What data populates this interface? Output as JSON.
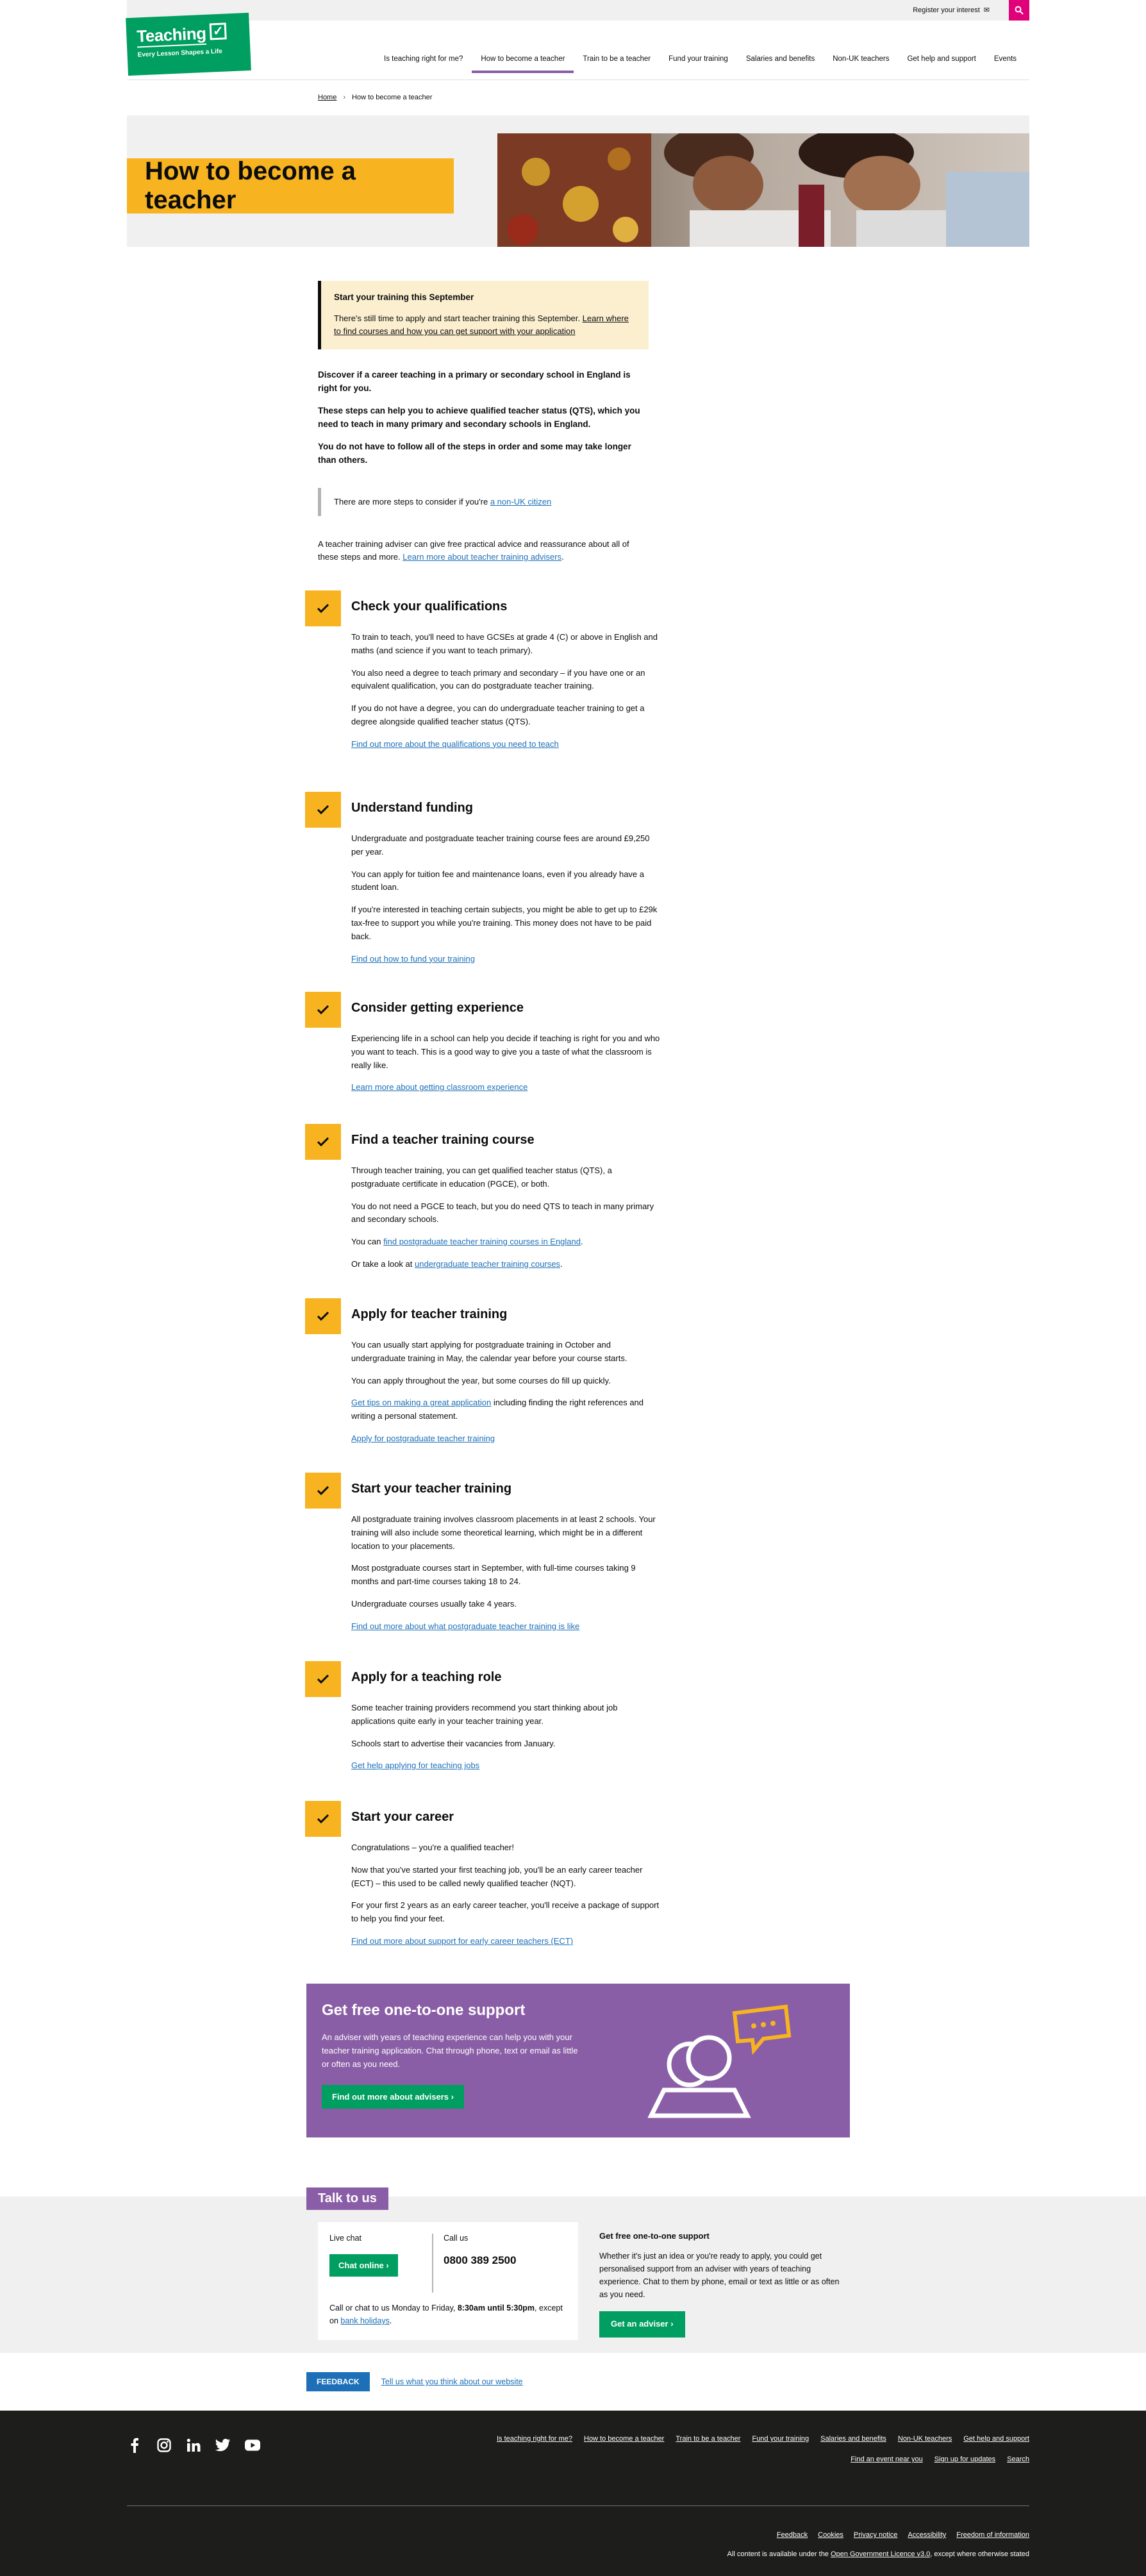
{
  "header": {
    "register_label": "Register your interest",
    "logo_brand": "Teaching",
    "logo_tagline": "Every Lesson Shapes a Life",
    "nav": [
      {
        "label": "Is teaching right for me?"
      },
      {
        "label": "How to become a teacher"
      },
      {
        "label": "Train to be a teacher"
      },
      {
        "label": "Fund your training"
      },
      {
        "label": "Salaries and benefits"
      },
      {
        "label": "Non-UK teachers"
      },
      {
        "label": "Get help and support"
      },
      {
        "label": "Events"
      }
    ]
  },
  "breadcrumb": {
    "home": "Home",
    "current": "How to become a teacher"
  },
  "hero": {
    "title": "How to become a teacher"
  },
  "notice": {
    "title": "Start your training this September",
    "text": "There's still time to apply and start teacher training this September. ",
    "link": "Learn where to find courses and how you can get support with your application"
  },
  "intro": {
    "p1": "Discover if a career teaching in a primary or secondary school in England is right for you.",
    "p2": "These steps can help you to achieve qualified teacher status (QTS), which you need to teach in many primary and secondary schools in England.",
    "p3": "You do not have to follow all of the steps in order and some may take longer than others."
  },
  "inset": {
    "text": "There are more steps to consider if you're ",
    "link": "a non-UK citizen"
  },
  "adviser_note": {
    "text": "A teacher training adviser can give free practical advice and reassurance about all of these steps and more. ",
    "link": "Learn more about teacher training advisers",
    "end": "."
  },
  "steps": [
    {
      "title": "Check your qualifications",
      "p1": "To train to teach, you'll need to have GCSEs at grade 4 (C) or above in English and maths (and science if you want to teach primary).",
      "p2": "You also need a degree to teach primary and secondary – if you have one or an equivalent qualification, you can do postgraduate teacher training.",
      "p3": "If you do not have a degree, you can do undergraduate teacher training to get a degree alongside qualified teacher status (QTS).",
      "link": "Find out more about the qualifications you need to teach"
    },
    {
      "title": "Understand funding",
      "p1": "Undergraduate and postgraduate teacher training course fees are around £9,250 per year.",
      "p2": "You can apply for tuition fee and maintenance loans, even if you already have a student loan.",
      "p3": "If you're interested in teaching certain subjects, you might be able to get up to £29k tax-free to support you while you're training. This money does not have to be paid back.",
      "link": "Find out how to fund your training"
    },
    {
      "title": "Consider getting experience",
      "p1": "Experiencing life in a school can help you decide if teaching is right for you and who you want to teach. This is a good way to give you a taste of what the classroom is really like.",
      "link": "Learn more about getting classroom experience"
    },
    {
      "title": "Find a teacher training course",
      "p1": "Through teacher training, you can get qualified teacher status (QTS), a postgraduate certificate in education (PGCE), or both.",
      "p2": "You do not need a PGCE to teach, but you do need QTS to teach in many primary and secondary schools.",
      "p3_pre": "You can ",
      "p3_link": "find postgraduate teacher training courses in England",
      "p3_post": ".",
      "p4_pre": "Or take a look at ",
      "p4_link": "undergraduate teacher training courses",
      "p4_post": "."
    },
    {
      "title": "Apply for teacher training",
      "p1": "You can usually start applying for postgraduate training in October and undergraduate training in May, the calendar year before your course starts.",
      "p2": "You can apply throughout the year, but some courses do fill up quickly.",
      "p3_link": "Get tips on making a great application",
      "p3_post": " including finding the right references and writing a personal statement.",
      "link": "Apply for postgraduate teacher training"
    },
    {
      "title": "Start your teacher training",
      "p1": "All postgraduate training involves classroom placements in at least 2 schools. Your training will also include some theoretical learning, which might be in a different location to your placements.",
      "p2": "Most postgraduate courses start in September, with full-time courses taking 9 months and part-time courses taking 18 to 24.",
      "p3": "Undergraduate courses usually take 4 years.",
      "link": "Find out more about what postgraduate teacher training is like"
    },
    {
      "title": "Apply for a teaching role",
      "p1": "Some teacher training providers recommend you start thinking about job applications quite early in your teacher training year.",
      "p2": "Schools start to advertise their vacancies from January.",
      "link": "Get help applying for teaching jobs"
    },
    {
      "title": "Start your career",
      "p1": "Congratulations – you're a qualified teacher!",
      "p2": "Now that you've started your first teaching job, you'll be an early career teacher (ECT) – this used to be called newly qualified teacher (NQT).",
      "p3": "For your first 2 years as an early career teacher, you'll receive a package of support to help you find your feet.",
      "link": "Find out more about support for early career teachers (ECT)"
    }
  ],
  "support": {
    "title": "Get free one-to-one support",
    "text": "An adviser with years of teaching experience can help you with your teacher training application. Chat through phone, text or email as little or often as you need.",
    "button": "Find out more about advisers"
  },
  "talk": {
    "tab": "Talk to us",
    "live_chat_label": "Live chat",
    "chat_button": "Chat online",
    "call_label": "Call us",
    "phone": "0800 389 2500",
    "hours_pre": "Call or chat to us Monday to Friday, ",
    "hours_bold": "8:30am until 5:30pm",
    "hours_mid": ", except on ",
    "hours_link": "bank holidays",
    "hours_end": ".",
    "side_title": "Get free one-to-one support",
    "side_text": "Whether it's just an idea or you're ready to apply, you could get personalised support from an adviser with years of teaching experience. Chat to them by phone, email or text as little or as often as you need.",
    "side_button": "Get an adviser"
  },
  "feedback": {
    "button": "FEEDBACK",
    "link": "Tell us what you think about our website"
  },
  "footer": {
    "links1": [
      "Is teaching right for me?",
      "How to become a teacher",
      "Train to be a teacher",
      "Fund your training",
      "Salaries and benefits",
      "Non-UK teachers",
      "Get help and support"
    ],
    "links2": [
      "Find an event near you",
      "Sign up for updates",
      "Search"
    ],
    "links3": [
      "Feedback",
      "Cookies",
      "Privacy notice",
      "Accessibility",
      "Freedom of information"
    ],
    "licence_pre": "All content is available under the ",
    "licence_link": "Open Government Licence v3.0",
    "licence_post": ", except where otherwise stated"
  },
  "colors": {
    "brand_green": "#009e60",
    "accent_yellow": "#f7b320",
    "purple": "#8a5ea6",
    "pink": "#e0007a",
    "link_blue": "#1d70b8"
  }
}
